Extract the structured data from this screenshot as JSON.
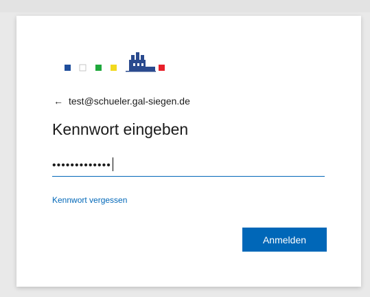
{
  "account": {
    "email": "test@schueler.gal-siegen.de",
    "back_icon": "arrow-left-icon"
  },
  "page": {
    "title": "Kennwort eingeben"
  },
  "password": {
    "masked_value": "•••••••••••••"
  },
  "links": {
    "forgot_password": "Kennwort vergessen"
  },
  "buttons": {
    "sign_in": "Anmelden"
  },
  "logo": {
    "squares": [
      "#1f4e9c",
      "#ffffff",
      "#1fa83c",
      "#f2d91e",
      "#e8202a",
      "#2bbcc4"
    ],
    "center_icon": "castle-emblem-icon"
  },
  "colors": {
    "accent": "#0067b8",
    "text": "#1b1b1b",
    "background": "#e9e9e9",
    "card": "#ffffff"
  }
}
